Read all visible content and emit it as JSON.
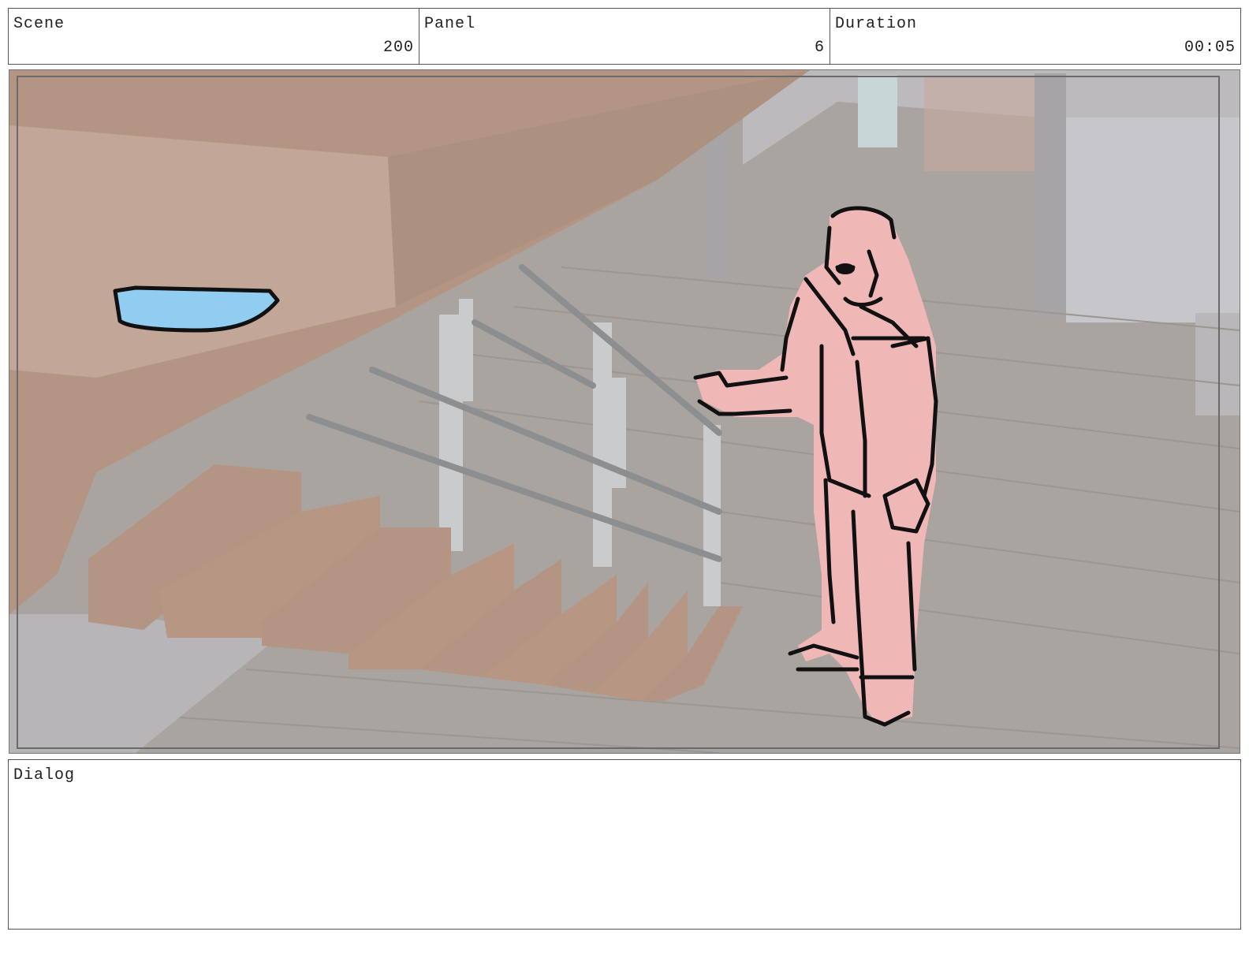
{
  "header": {
    "scene": {
      "label": "Scene",
      "value": "200"
    },
    "panel": {
      "label": "Panel",
      "value": "6"
    },
    "duration": {
      "label": "Duration",
      "value": "00:05"
    }
  },
  "dialog": {
    "label": "Dialog",
    "text": ""
  },
  "colors": {
    "border": "#555555",
    "background_tint": "#a9a49f",
    "stair_wood": "#b49482",
    "character_fill": "#efb8b6",
    "water_blue": "#91cdf0",
    "outline": "#111111"
  },
  "icons": [
    "storyboard-drawing"
  ]
}
